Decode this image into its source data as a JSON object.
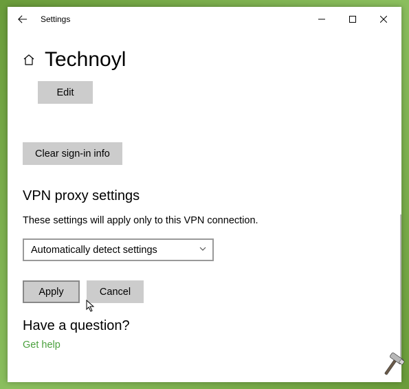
{
  "window": {
    "title": "Settings"
  },
  "page": {
    "name": "Technoyl",
    "edit_label": "Edit",
    "clear_label": "Clear sign-in info"
  },
  "proxy": {
    "heading": "VPN proxy settings",
    "description": "These settings will apply only to this VPN connection.",
    "selected": "Automatically detect settings",
    "apply_label": "Apply",
    "cancel_label": "Cancel"
  },
  "help": {
    "heading": "Have a question?",
    "link": "Get help"
  },
  "colors": {
    "accent": "#4aa03d",
    "button_bg": "#cccccc"
  }
}
